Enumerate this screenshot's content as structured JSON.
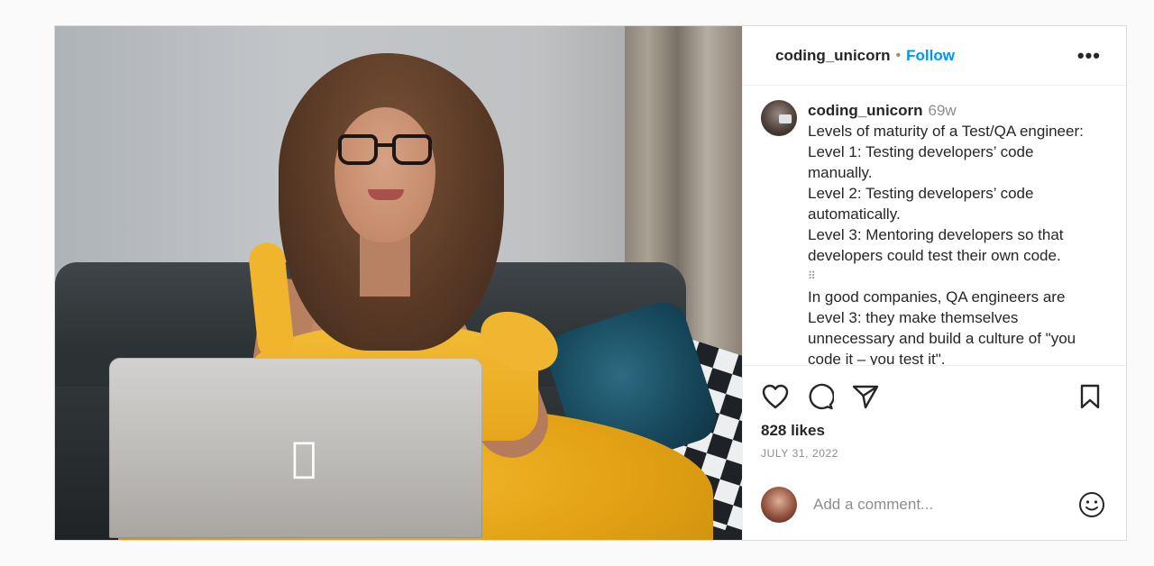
{
  "post": {
    "username": "coding_unicorn",
    "dot": "•",
    "follow_label": "Follow",
    "more_label": "•••",
    "caption": {
      "username": "coding_unicorn",
      "ago": "69w",
      "lines": [
        "Levels of maturity of a Test/QA engineer:",
        "Level 1: Testing developers’ code",
        "manually.",
        "Level 2: Testing developers’ code",
        "automatically.",
        "Level 3: Mentoring developers so that",
        "developers could test their own code.",
        "⠿",
        "In good companies, QA engineers are",
        "Level 3: they make themselves",
        "unnecessary and build a culture of \"you",
        "code it – you test it\"."
      ]
    },
    "likes": "828 likes",
    "date": "JULY 31, 2022",
    "comment_placeholder": "Add a comment...",
    "icons": {
      "like": "heart-icon",
      "comment": "comment-icon",
      "share": "send-icon",
      "save": "bookmark-icon",
      "emoji": "emoji-icon"
    },
    "colors": {
      "follow": "#0095f6",
      "text": "#262626",
      "muted": "#8e8e8e",
      "border": "#dbdbdb"
    }
  }
}
